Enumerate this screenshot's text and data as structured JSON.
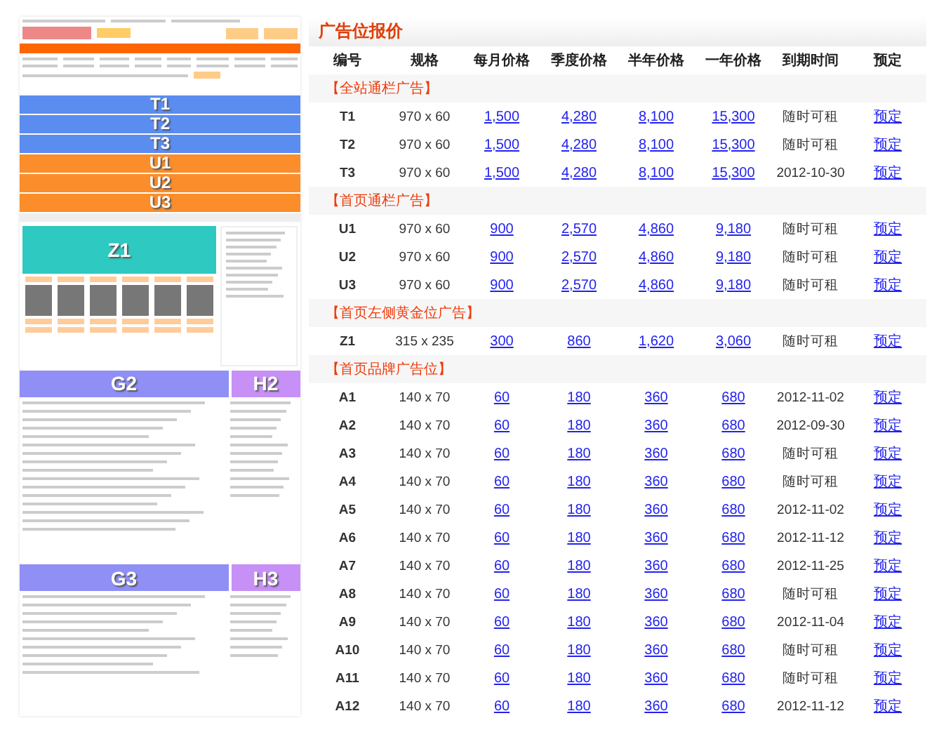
{
  "layout_preview": {
    "banners": [
      {
        "label": "T1",
        "color": "#5b8cf0"
      },
      {
        "label": "T2",
        "color": "#5b8cf0"
      },
      {
        "label": "T3",
        "color": "#5b8cf0"
      },
      {
        "label": "U1",
        "color": "#fb8d2a"
      },
      {
        "label": "U2",
        "color": "#fb8d2a"
      },
      {
        "label": "U3",
        "color": "#fb8d2a"
      }
    ],
    "feature": {
      "label": "Z1",
      "color": "#2ec9c1"
    },
    "pairs": [
      {
        "left": {
          "label": "G2",
          "color": "#8f8ff6"
        },
        "right": {
          "label": "H2",
          "color": "#c690f6"
        }
      },
      {
        "left": {
          "label": "G3",
          "color": "#8f8ff6"
        },
        "right": {
          "label": "H3",
          "color": "#c690f6"
        }
      }
    ]
  },
  "price_table": {
    "title": "广告位报价",
    "columns": [
      "编号",
      "规格",
      "每月价格",
      "季度价格",
      "半年价格",
      "一年价格",
      "到期时间",
      "预定"
    ],
    "sections": [
      {
        "title": "【全站通栏广告】",
        "rows": [
          {
            "id": "T1",
            "size": "970 x 60",
            "month": "1,500",
            "quarter": "4,280",
            "half_year": "8,100",
            "year": "15,300",
            "expiry": "随时可租",
            "action": "预定"
          },
          {
            "id": "T2",
            "size": "970 x 60",
            "month": "1,500",
            "quarter": "4,280",
            "half_year": "8,100",
            "year": "15,300",
            "expiry": "随时可租",
            "action": "预定"
          },
          {
            "id": "T3",
            "size": "970 x 60",
            "month": "1,500",
            "quarter": "4,280",
            "half_year": "8,100",
            "year": "15,300",
            "expiry": "2012-10-30",
            "action": "预定"
          }
        ]
      },
      {
        "title": "【首页通栏广告】",
        "rows": [
          {
            "id": "U1",
            "size": "970 x 60",
            "month": "900",
            "quarter": "2,570",
            "half_year": "4,860",
            "year": "9,180",
            "expiry": "随时可租",
            "action": "预定"
          },
          {
            "id": "U2",
            "size": "970 x 60",
            "month": "900",
            "quarter": "2,570",
            "half_year": "4,860",
            "year": "9,180",
            "expiry": "随时可租",
            "action": "预定"
          },
          {
            "id": "U3",
            "size": "970 x 60",
            "month": "900",
            "quarter": "2,570",
            "half_year": "4,860",
            "year": "9,180",
            "expiry": "随时可租",
            "action": "预定"
          }
        ]
      },
      {
        "title": "【首页左侧黄金位广告】",
        "rows": [
          {
            "id": "Z1",
            "size": "315 x 235",
            "month": "300",
            "quarter": "860",
            "half_year": "1,620",
            "year": "3,060",
            "expiry": "随时可租",
            "action": "预定"
          }
        ]
      },
      {
        "title": "【首页品牌广告位】",
        "rows": [
          {
            "id": "A1",
            "size": "140 x 70",
            "month": "60",
            "quarter": "180",
            "half_year": "360",
            "year": "680",
            "expiry": "2012-11-02",
            "action": "预定"
          },
          {
            "id": "A2",
            "size": "140 x 70",
            "month": "60",
            "quarter": "180",
            "half_year": "360",
            "year": "680",
            "expiry": "2012-09-30",
            "action": "预定"
          },
          {
            "id": "A3",
            "size": "140 x 70",
            "month": "60",
            "quarter": "180",
            "half_year": "360",
            "year": "680",
            "expiry": "随时可租",
            "action": "预定"
          },
          {
            "id": "A4",
            "size": "140 x 70",
            "month": "60",
            "quarter": "180",
            "half_year": "360",
            "year": "680",
            "expiry": "随时可租",
            "action": "预定"
          },
          {
            "id": "A5",
            "size": "140 x 70",
            "month": "60",
            "quarter": "180",
            "half_year": "360",
            "year": "680",
            "expiry": "2012-11-02",
            "action": "预定"
          },
          {
            "id": "A6",
            "size": "140 x 70",
            "month": "60",
            "quarter": "180",
            "half_year": "360",
            "year": "680",
            "expiry": "2012-11-12",
            "action": "预定"
          },
          {
            "id": "A7",
            "size": "140 x 70",
            "month": "60",
            "quarter": "180",
            "half_year": "360",
            "year": "680",
            "expiry": "2012-11-25",
            "action": "预定"
          },
          {
            "id": "A8",
            "size": "140 x 70",
            "month": "60",
            "quarter": "180",
            "half_year": "360",
            "year": "680",
            "expiry": "随时可租",
            "action": "预定"
          },
          {
            "id": "A9",
            "size": "140 x 70",
            "month": "60",
            "quarter": "180",
            "half_year": "360",
            "year": "680",
            "expiry": "2012-11-04",
            "action": "预定"
          },
          {
            "id": "A10",
            "size": "140 x 70",
            "month": "60",
            "quarter": "180",
            "half_year": "360",
            "year": "680",
            "expiry": "随时可租",
            "action": "预定"
          },
          {
            "id": "A11",
            "size": "140 x 70",
            "month": "60",
            "quarter": "180",
            "half_year": "360",
            "year": "680",
            "expiry": "随时可租",
            "action": "预定"
          },
          {
            "id": "A12",
            "size": "140 x 70",
            "month": "60",
            "quarter": "180",
            "half_year": "360",
            "year": "680",
            "expiry": "2012-11-12",
            "action": "预定"
          }
        ]
      }
    ]
  }
}
